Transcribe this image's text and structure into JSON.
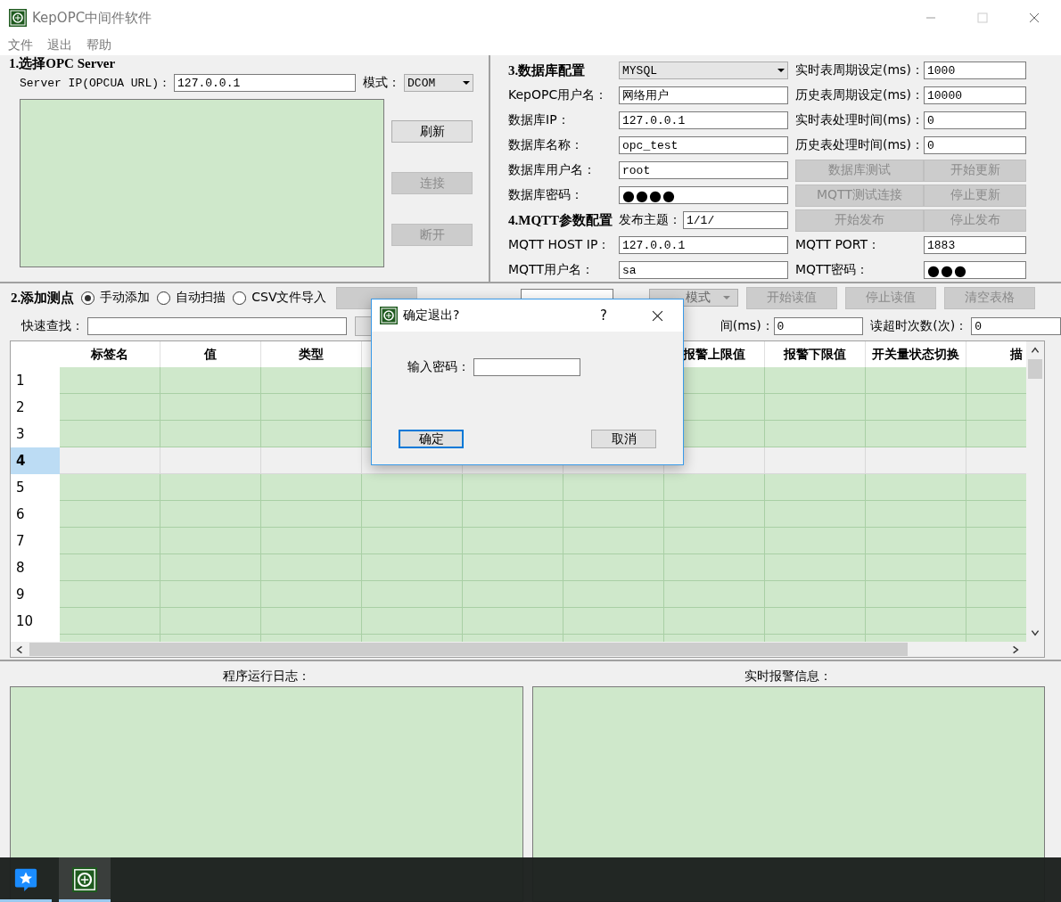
{
  "window": {
    "title": "KepOPC中间件软件"
  },
  "menu": [
    "文件",
    "退出",
    "帮助"
  ],
  "opc_server": {
    "title": "1.选择OPC Server",
    "ip_label": "Server IP(OPCUA URL)：",
    "ip_value": "127.0.0.1",
    "mode_label": "模式：",
    "mode_value": "DCOM",
    "buttons": [
      {
        "label": "刷新",
        "disabled": false
      },
      {
        "label": "连接",
        "disabled": true
      },
      {
        "label": "断开",
        "disabled": true
      }
    ]
  },
  "config_rows": [
    [
      {
        "kind": "heading",
        "text": "3.数据库配置"
      },
      {
        "kind": "combo",
        "text": "MYSQL"
      },
      {
        "kind": "label",
        "text": "实时表周期设定(ms)："
      },
      {
        "kind": "field",
        "text": "1000"
      }
    ],
    [
      {
        "kind": "label",
        "text": "KepOPC用户名："
      },
      {
        "kind": "field",
        "text": "网络用户"
      },
      {
        "kind": "label",
        "text": "历史表周期设定(ms)："
      },
      {
        "kind": "field",
        "text": "10000"
      }
    ],
    [
      {
        "kind": "label",
        "text": "数据库IP："
      },
      {
        "kind": "field",
        "text": "127.0.0.1"
      },
      {
        "kind": "label",
        "text": "实时表处理时间(ms)："
      },
      {
        "kind": "field",
        "text": "0"
      }
    ],
    [
      {
        "kind": "label",
        "text": "数据库名称："
      },
      {
        "kind": "field",
        "text": "opc_test"
      },
      {
        "kind": "label",
        "text": "历史表处理时间(ms)："
      },
      {
        "kind": "field",
        "text": "0"
      }
    ],
    [
      {
        "kind": "label",
        "text": "数据库用户名："
      },
      {
        "kind": "field",
        "text": "root"
      },
      {
        "kind": "button",
        "text": "数据库测试",
        "disabled": true
      },
      {
        "kind": "button",
        "text": "开始更新",
        "disabled": true
      }
    ],
    [
      {
        "kind": "label",
        "text": "数据库密码："
      },
      {
        "kind": "password",
        "text": "●●●●"
      },
      {
        "kind": "button",
        "text": "MQTT测试连接",
        "disabled": true
      },
      {
        "kind": "button",
        "text": "停止更新",
        "disabled": true
      }
    ],
    [
      {
        "kind": "heading",
        "text": "4.MQTT参数配置"
      },
      {
        "kind": "labeled_field",
        "label": "发布主题：",
        "text": "1/1/"
      },
      {
        "kind": "button",
        "text": "开始发布",
        "disabled": true
      },
      {
        "kind": "button",
        "text": "停止发布",
        "disabled": true
      }
    ],
    [
      {
        "kind": "label",
        "text": "MQTT HOST IP："
      },
      {
        "kind": "field",
        "text": "127.0.0.1"
      },
      {
        "kind": "label",
        "text": "MQTT PORT："
      },
      {
        "kind": "field",
        "text": "1883"
      }
    ],
    [
      {
        "kind": "label",
        "text": "MQTT用户名："
      },
      {
        "kind": "field",
        "text": "sa"
      },
      {
        "kind": "label",
        "text": "MQTT密码："
      },
      {
        "kind": "password",
        "text": "●●●"
      }
    ]
  ],
  "points": {
    "title": "2.添加测点",
    "radios": [
      {
        "label": "手动添加",
        "selected": true
      },
      {
        "label": "自动扫描",
        "selected": false
      },
      {
        "label": "CSV文件导入",
        "selected": false
      }
    ],
    "query_mode": "模式",
    "buttons": [
      {
        "label": "开始读值",
        "disabled": true
      },
      {
        "label": "停止读值",
        "disabled": true
      },
      {
        "label": "清空表格",
        "disabled": true
      }
    ],
    "search_label": "快速查找：",
    "read_time_label": "间(ms)：",
    "read_time_value": "0",
    "timeout_label": "读超时次数(次)：",
    "timeout_value": "0"
  },
  "table": {
    "columns": [
      {
        "label": "标签名"
      },
      {
        "label": "值"
      },
      {
        "label": "类型"
      },
      {},
      {},
      {},
      {
        "label": "报警上限值"
      },
      {
        "label": "报警下限值"
      },
      {
        "label": "开关量状态切换"
      },
      {
        "label": "描"
      }
    ],
    "rows": [
      {
        "label": "1",
        "selected": false
      },
      {
        "label": "2",
        "selected": false
      },
      {
        "label": "3",
        "selected": false
      },
      {
        "label": "4",
        "selected": true
      },
      {
        "label": "5",
        "selected": false
      },
      {
        "label": "6",
        "selected": false
      },
      {
        "label": "7",
        "selected": false
      },
      {
        "label": "8",
        "selected": false
      },
      {
        "label": "9",
        "selected": false
      },
      {
        "label": "10",
        "selected": false
      }
    ]
  },
  "logs": [
    {
      "title": "程序运行日志："
    },
    {
      "title": "实时报警信息："
    }
  ],
  "dialog": {
    "title": "确定退出?",
    "help": "?",
    "password_label": "输入密码：",
    "buttons": [
      {
        "label": "确定",
        "default": true
      },
      {
        "label": "取消",
        "default": false
      }
    ]
  },
  "taskbar": [
    {
      "kind": "chat",
      "active": false
    },
    {
      "kind": "app",
      "active": true
    }
  ]
}
